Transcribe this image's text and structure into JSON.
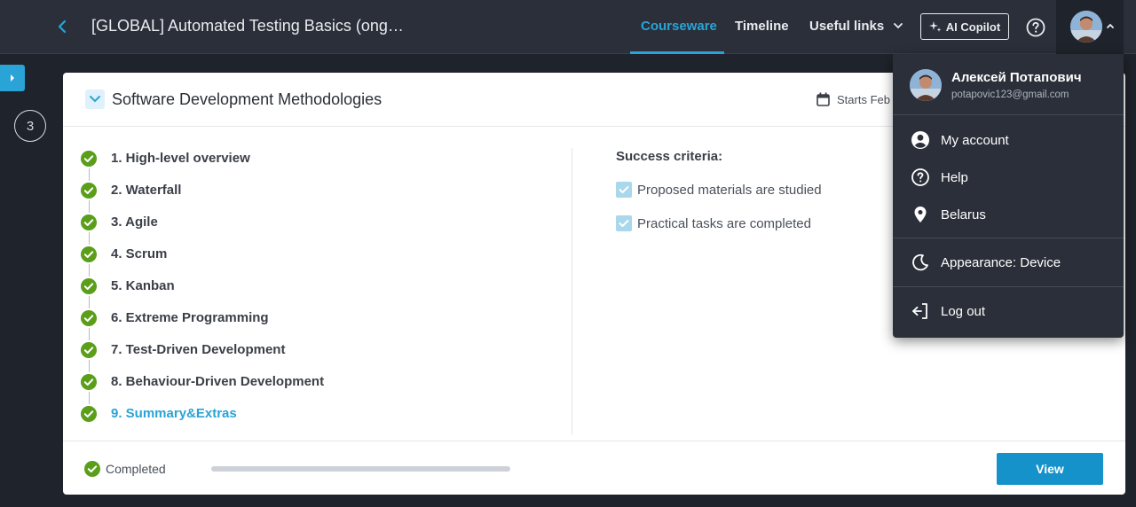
{
  "header": {
    "title": "[GLOBAL] Automated Testing Basics (ong…",
    "nav": [
      "Courseware",
      "Timeline",
      "Useful links"
    ],
    "copilot_label": "AI Copilot"
  },
  "sidebar": {
    "step_number": "3"
  },
  "section": {
    "title": "Software Development Methodologies",
    "starts": "Starts Feb",
    "lessons": [
      "1. High-level overview",
      "2. Waterfall",
      "3. Agile",
      "4. Scrum",
      "5. Kanban",
      "6. Extreme Programming",
      "7. Test-Driven Development",
      "8. Behaviour-Driven Development",
      "9. Summary&Extras"
    ],
    "criteria_title": "Success criteria:",
    "criteria": [
      "Proposed materials are studied",
      "Practical tasks are completed"
    ],
    "status": "Completed",
    "progress": 1.0,
    "view_label": "View"
  },
  "user_menu": {
    "name": "Алексей Потапович",
    "email": "potapovic123@gmail.com",
    "items": [
      "My account",
      "Help",
      "Belarus",
      "Appearance: Device",
      "Log out"
    ]
  },
  "colors": {
    "accent": "#2aa3d6",
    "success": "#5a9e1a",
    "topbar": "#2a2f39",
    "button": "#1592c9"
  }
}
